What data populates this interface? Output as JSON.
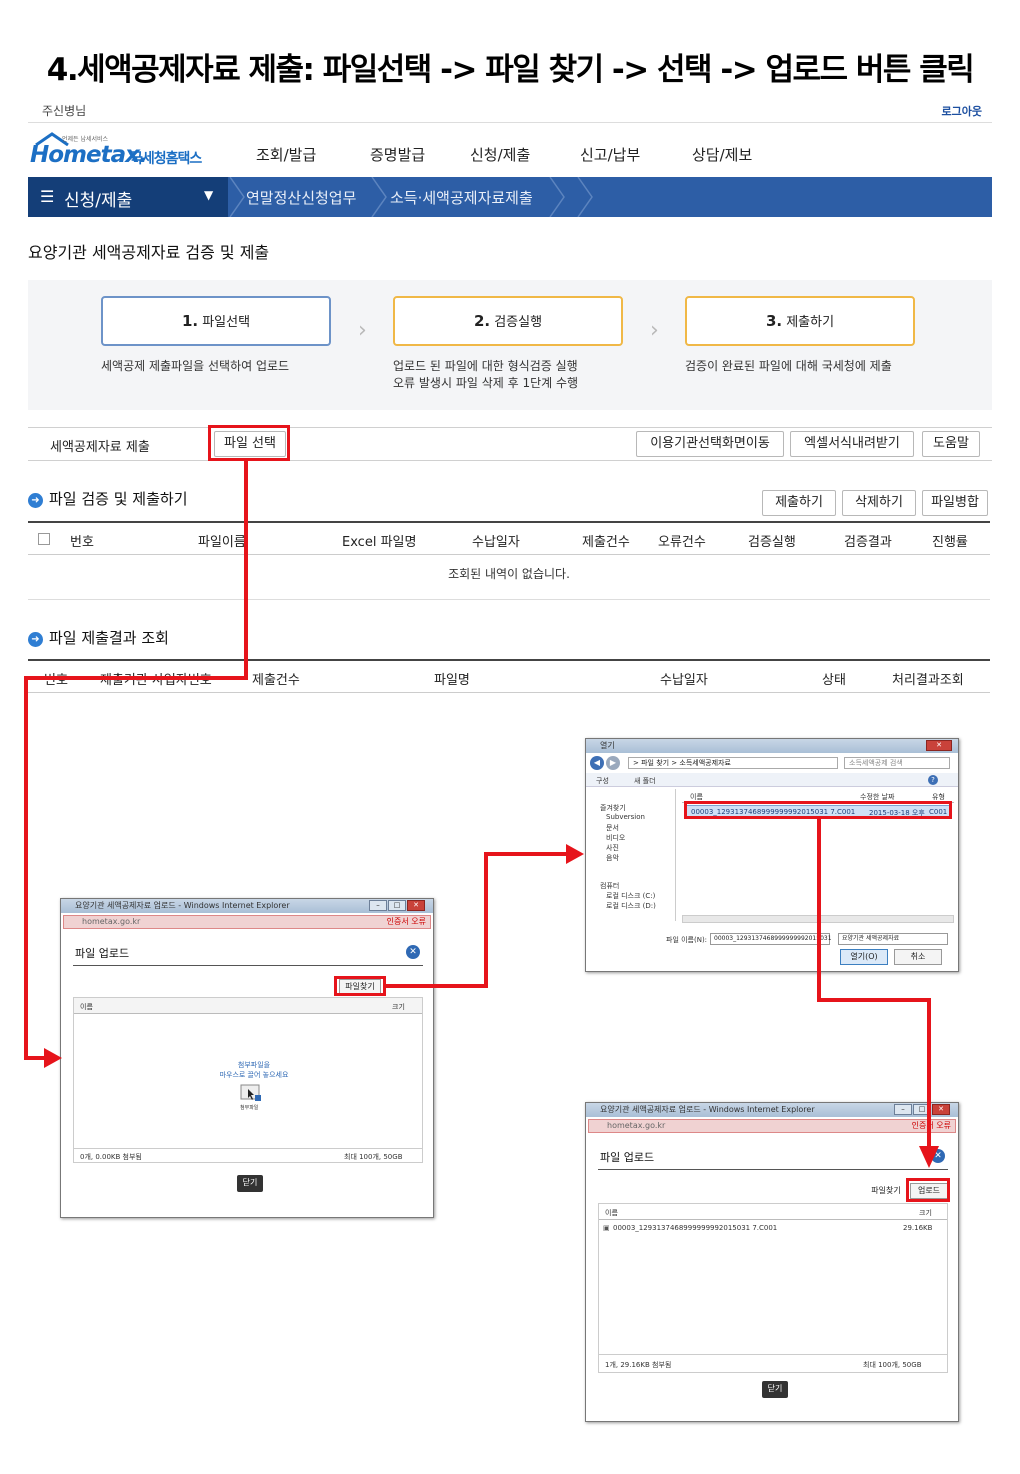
{
  "title": "4.세액공제자료 제출: 파일선택 -> 파일 찾기 -> 선택 -> 업로드 버튼 클릭",
  "header": {
    "user": "주신병님",
    "logout": "로그아웃",
    "logo_small": "언제든 납세서비스",
    "logo_home": "Hometax.",
    "logo_name": "국세청홈택스",
    "menu": [
      "조회/발급",
      "증명발급",
      "신청/제출",
      "신고/납부",
      "상담/제보"
    ]
  },
  "nav": {
    "first": "신청/제출",
    "crumb1": "연말정산신청업무",
    "crumb2": "소득·세액공제자료제출"
  },
  "section_title": "요양기관 세액공제자료 검증 및 제출",
  "steps": [
    {
      "num": "1.",
      "label": "파일선택",
      "desc1": "세액공제 제출파일을 선택하여 업로드",
      "desc2": ""
    },
    {
      "num": "2.",
      "label": "검증실행",
      "desc1": "업로드 된 파일에 대한 형식검증 실행",
      "desc2": "오류 발생시 파일 삭제 후 1단계 수행"
    },
    {
      "num": "3.",
      "label": "제출하기",
      "desc1": "검증이 완료된 파일에 대해 국세청에 제출",
      "desc2": ""
    }
  ],
  "toolbar": {
    "label": "세액공제자료 제출",
    "select_file": "파일 선택",
    "move_btn": "이용기관선택화면이동",
    "excel_btn": "엑셀서식내려받기",
    "help_btn": "도움말"
  },
  "verify": {
    "heading": "파일 검증 및 제출하기",
    "submit_btn": "제출하기",
    "delete_btn": "삭제하기",
    "merge_btn": "파일병합",
    "columns": [
      "번호",
      "파일이름",
      "Excel 파일명",
      "수납일자",
      "제출건수",
      "오류건수",
      "검증실행",
      "검증결과",
      "진행률"
    ],
    "empty": "조회된 내역이 없습니다."
  },
  "result": {
    "heading": "파일 제출결과 조회",
    "columns": [
      "번호",
      "제출기관 사업자번호",
      "제출건수",
      "파일명",
      "수납일자",
      "상태",
      "처리결과조회"
    ]
  },
  "dialog_upload": {
    "window_title": "요양기관 세액공제자료 업로드 - Windows Internet Explorer",
    "address": "hometax.go.kr",
    "addr_note": "인증서 오류",
    "title": "파일 업로드",
    "find_btn": "파일찾기",
    "col_name": "이름",
    "col_size": "크기",
    "drop_hint1": "첨부파일을",
    "drop_hint2": "마우스로 끌어 놓으세요",
    "drop_caption": "첨부파일",
    "status_left": "0개, 0.00KB 첨부됨",
    "status_right": "최대 100개, 50GB",
    "close_btn": "닫기"
  },
  "dialog_open": {
    "window_title": "열기",
    "path": "> 파일 찾기 > 소득세액공제자료",
    "search": "소득세액공제 검색",
    "organize": "구성",
    "new_folder": "새 폴더",
    "col_name": "이름",
    "col_date": "수정한 날짜",
    "col_type": "유형",
    "file_name": "00003_1293137468999999992015031 7.C001",
    "file_date": "2015-03-18 오후",
    "file_type": "C001",
    "tree": [
      "즐겨찾기",
      "Subversion",
      "문서",
      "비디오",
      "사진",
      "음악",
      "컴퓨터",
      "로컬 디스크 (C:)",
      "로컬 디스크 (D:)"
    ],
    "filename_label": "파일 이름(N):",
    "filename_value": "00003_1293137468999999992015031",
    "filter": "요양기관 세액공제자료",
    "open_btn": "열기(O)",
    "cancel_btn": "취소"
  },
  "dialog_uploaded": {
    "window_title": "요양기관 세액공제자료 업로드 - Windows Internet Explorer",
    "address": "hometax.go.kr",
    "addr_note": "인증서 오류",
    "title": "파일 업로드",
    "find_btn": "파일찾기",
    "upload_btn": "업로드",
    "col_name": "이름",
    "col_size": "크기",
    "file_row": "00003_1293137468999999992015031 7.C001",
    "file_size": "29.16KB",
    "status_left": "1개, 29.16KB 첨부됨",
    "status_right": "최대 100개, 50GB",
    "close_btn": "닫기"
  }
}
